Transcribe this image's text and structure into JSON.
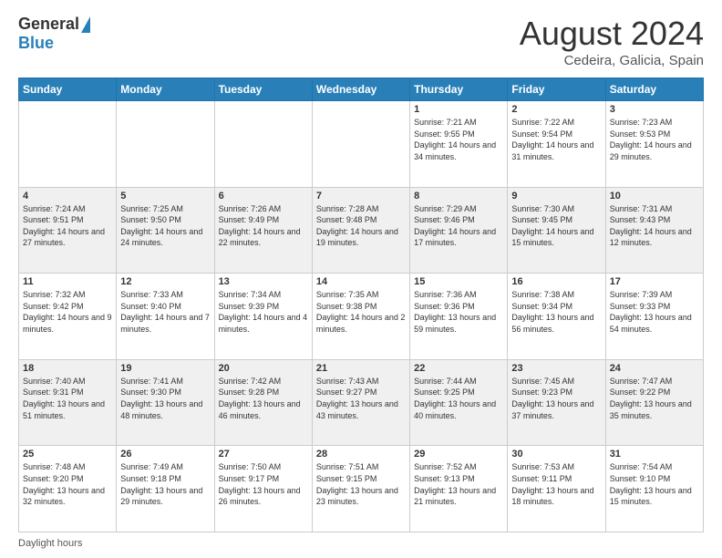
{
  "header": {
    "logo_general": "General",
    "logo_blue": "Blue",
    "month_title": "August 2024",
    "subtitle": "Cedeira, Galicia, Spain"
  },
  "footer": {
    "label": "Daylight hours"
  },
  "weekdays": [
    "Sunday",
    "Monday",
    "Tuesday",
    "Wednesday",
    "Thursday",
    "Friday",
    "Saturday"
  ],
  "weeks": [
    [
      {
        "day": "",
        "info": ""
      },
      {
        "day": "",
        "info": ""
      },
      {
        "day": "",
        "info": ""
      },
      {
        "day": "",
        "info": ""
      },
      {
        "day": "1",
        "info": "Sunrise: 7:21 AM\nSunset: 9:55 PM\nDaylight: 14 hours\nand 34 minutes."
      },
      {
        "day": "2",
        "info": "Sunrise: 7:22 AM\nSunset: 9:54 PM\nDaylight: 14 hours\nand 31 minutes."
      },
      {
        "day": "3",
        "info": "Sunrise: 7:23 AM\nSunset: 9:53 PM\nDaylight: 14 hours\nand 29 minutes."
      }
    ],
    [
      {
        "day": "4",
        "info": "Sunrise: 7:24 AM\nSunset: 9:51 PM\nDaylight: 14 hours\nand 27 minutes."
      },
      {
        "day": "5",
        "info": "Sunrise: 7:25 AM\nSunset: 9:50 PM\nDaylight: 14 hours\nand 24 minutes."
      },
      {
        "day": "6",
        "info": "Sunrise: 7:26 AM\nSunset: 9:49 PM\nDaylight: 14 hours\nand 22 minutes."
      },
      {
        "day": "7",
        "info": "Sunrise: 7:28 AM\nSunset: 9:48 PM\nDaylight: 14 hours\nand 19 minutes."
      },
      {
        "day": "8",
        "info": "Sunrise: 7:29 AM\nSunset: 9:46 PM\nDaylight: 14 hours\nand 17 minutes."
      },
      {
        "day": "9",
        "info": "Sunrise: 7:30 AM\nSunset: 9:45 PM\nDaylight: 14 hours\nand 15 minutes."
      },
      {
        "day": "10",
        "info": "Sunrise: 7:31 AM\nSunset: 9:43 PM\nDaylight: 14 hours\nand 12 minutes."
      }
    ],
    [
      {
        "day": "11",
        "info": "Sunrise: 7:32 AM\nSunset: 9:42 PM\nDaylight: 14 hours\nand 9 minutes."
      },
      {
        "day": "12",
        "info": "Sunrise: 7:33 AM\nSunset: 9:40 PM\nDaylight: 14 hours\nand 7 minutes."
      },
      {
        "day": "13",
        "info": "Sunrise: 7:34 AM\nSunset: 9:39 PM\nDaylight: 14 hours\nand 4 minutes."
      },
      {
        "day": "14",
        "info": "Sunrise: 7:35 AM\nSunset: 9:38 PM\nDaylight: 14 hours\nand 2 minutes."
      },
      {
        "day": "15",
        "info": "Sunrise: 7:36 AM\nSunset: 9:36 PM\nDaylight: 13 hours\nand 59 minutes."
      },
      {
        "day": "16",
        "info": "Sunrise: 7:38 AM\nSunset: 9:34 PM\nDaylight: 13 hours\nand 56 minutes."
      },
      {
        "day": "17",
        "info": "Sunrise: 7:39 AM\nSunset: 9:33 PM\nDaylight: 13 hours\nand 54 minutes."
      }
    ],
    [
      {
        "day": "18",
        "info": "Sunrise: 7:40 AM\nSunset: 9:31 PM\nDaylight: 13 hours\nand 51 minutes."
      },
      {
        "day": "19",
        "info": "Sunrise: 7:41 AM\nSunset: 9:30 PM\nDaylight: 13 hours\nand 48 minutes."
      },
      {
        "day": "20",
        "info": "Sunrise: 7:42 AM\nSunset: 9:28 PM\nDaylight: 13 hours\nand 46 minutes."
      },
      {
        "day": "21",
        "info": "Sunrise: 7:43 AM\nSunset: 9:27 PM\nDaylight: 13 hours\nand 43 minutes."
      },
      {
        "day": "22",
        "info": "Sunrise: 7:44 AM\nSunset: 9:25 PM\nDaylight: 13 hours\nand 40 minutes."
      },
      {
        "day": "23",
        "info": "Sunrise: 7:45 AM\nSunset: 9:23 PM\nDaylight: 13 hours\nand 37 minutes."
      },
      {
        "day": "24",
        "info": "Sunrise: 7:47 AM\nSunset: 9:22 PM\nDaylight: 13 hours\nand 35 minutes."
      }
    ],
    [
      {
        "day": "25",
        "info": "Sunrise: 7:48 AM\nSunset: 9:20 PM\nDaylight: 13 hours\nand 32 minutes."
      },
      {
        "day": "26",
        "info": "Sunrise: 7:49 AM\nSunset: 9:18 PM\nDaylight: 13 hours\nand 29 minutes."
      },
      {
        "day": "27",
        "info": "Sunrise: 7:50 AM\nSunset: 9:17 PM\nDaylight: 13 hours\nand 26 minutes."
      },
      {
        "day": "28",
        "info": "Sunrise: 7:51 AM\nSunset: 9:15 PM\nDaylight: 13 hours\nand 23 minutes."
      },
      {
        "day": "29",
        "info": "Sunrise: 7:52 AM\nSunset: 9:13 PM\nDaylight: 13 hours\nand 21 minutes."
      },
      {
        "day": "30",
        "info": "Sunrise: 7:53 AM\nSunset: 9:11 PM\nDaylight: 13 hours\nand 18 minutes."
      },
      {
        "day": "31",
        "info": "Sunrise: 7:54 AM\nSunset: 9:10 PM\nDaylight: 13 hours\nand 15 minutes."
      }
    ]
  ]
}
